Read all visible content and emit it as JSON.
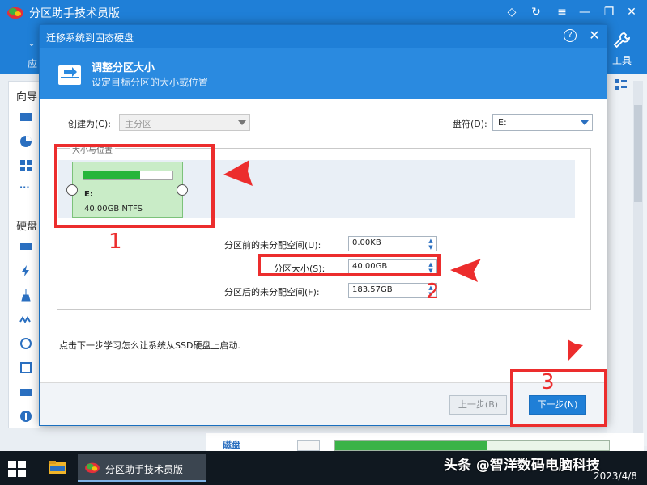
{
  "app": {
    "title": "分区助手技术员版",
    "toolbar_partial_label": "应",
    "tools_label": "工具",
    "left_panel": {
      "section_wizard": "向导",
      "section_disk": "硬盘"
    }
  },
  "dialog": {
    "title": "迁移系统到固态硬盘",
    "header": {
      "title": "调整分区大小",
      "subtitle": "设定目标分区的大小或位置"
    },
    "create_as_label": "创建为(C):",
    "create_as_value": "主分区",
    "drive_letter_label": "盘符(D):",
    "drive_letter_value": "E:",
    "group_title": "大小与位置",
    "partition": {
      "name": "E:",
      "size_text": "40.00GB NTFS",
      "used_fraction": 0.64
    },
    "fields": [
      {
        "label": "分区前的未分配空间(U):",
        "value": "0.00KB"
      },
      {
        "label": "分区大小(S):",
        "value": "40.00GB"
      },
      {
        "label": "分区后的未分配空间(F):",
        "value": "183.57GB"
      }
    ],
    "hint": "点击下一步学习怎么让系统从SSD硬盘上启动.",
    "prev_label": "上一步(B)",
    "next_label": "下一步(N)"
  },
  "annotations": {
    "n1": "1",
    "n2": "2",
    "n3": "3",
    "color": "#ec2d2d"
  },
  "taskbar": {
    "app_label": "分区助手技术员版",
    "watermark": "头条 @智洋数码电脑科技",
    "date": "2023/4/8"
  },
  "background_disk": {
    "label": "磁盘"
  }
}
